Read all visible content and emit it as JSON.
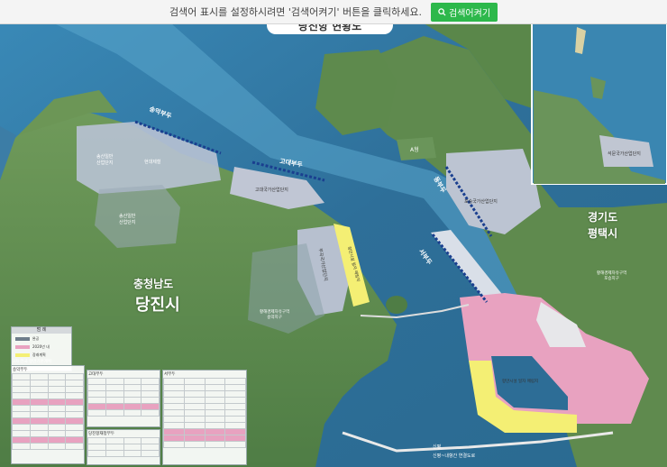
{
  "banner": {
    "message": "검색어 표시를 설정하시려면 '검색어켜기' 버튼을 클릭하세요.",
    "button_label": "검색어켜기",
    "button_icon": "search-icon"
  },
  "map": {
    "title_fragment": "당진항 현황도",
    "province": "충청남도",
    "city": "당진시",
    "neighbor_province": "경기도",
    "neighbor_city": "평택시",
    "labels": {
      "songak_pier": "송악부두",
      "godae_pier": "고대부두",
      "dongbu_pier": "동부두",
      "seobu_pier": "서부두",
      "songsan_industrial": "송산일반\n산업단지",
      "hyundai_steel": "현대제철",
      "songsan_industrial_2": "송산일반\n산업단지",
      "godae_complex": "고대국가산업단지",
      "buried_land": "부곡국가산업단지",
      "hwanghae_free_zone": "황해경제자유구역\n송악지구",
      "poseung_complex": "포승국가산업단지",
      "hwanghae_poseung": "황해경제자유구역\n포승지구",
      "a_label": "A형",
      "jangeun_complex": "석문국가산업단지",
      "port_expansion": "항만시설 일자 매립지",
      "port_expansion_2": "항만시설 일자 매립지",
      "bridge": "신평~내항간 연결도로",
      "shinpyeong": "신평"
    },
    "colors": {
      "sea": "#2f7aa8",
      "land": "#5f8a4e",
      "industrial": "#b9c3d2",
      "reclaimed_pink": "#e8a2c0",
      "reclaimed_yellow": "#f4ef74"
    }
  },
  "legend": {
    "title": "범 례",
    "items": [
      "완공",
      "2020년 내",
      "장래계획"
    ],
    "subtitle": "3차 전국 항만기본계획"
  },
  "tables": [
    {
      "title": "송악부두"
    },
    {
      "title": "고대부두"
    },
    {
      "title": "당진항재정부두"
    },
    {
      "title": "서부두"
    }
  ]
}
